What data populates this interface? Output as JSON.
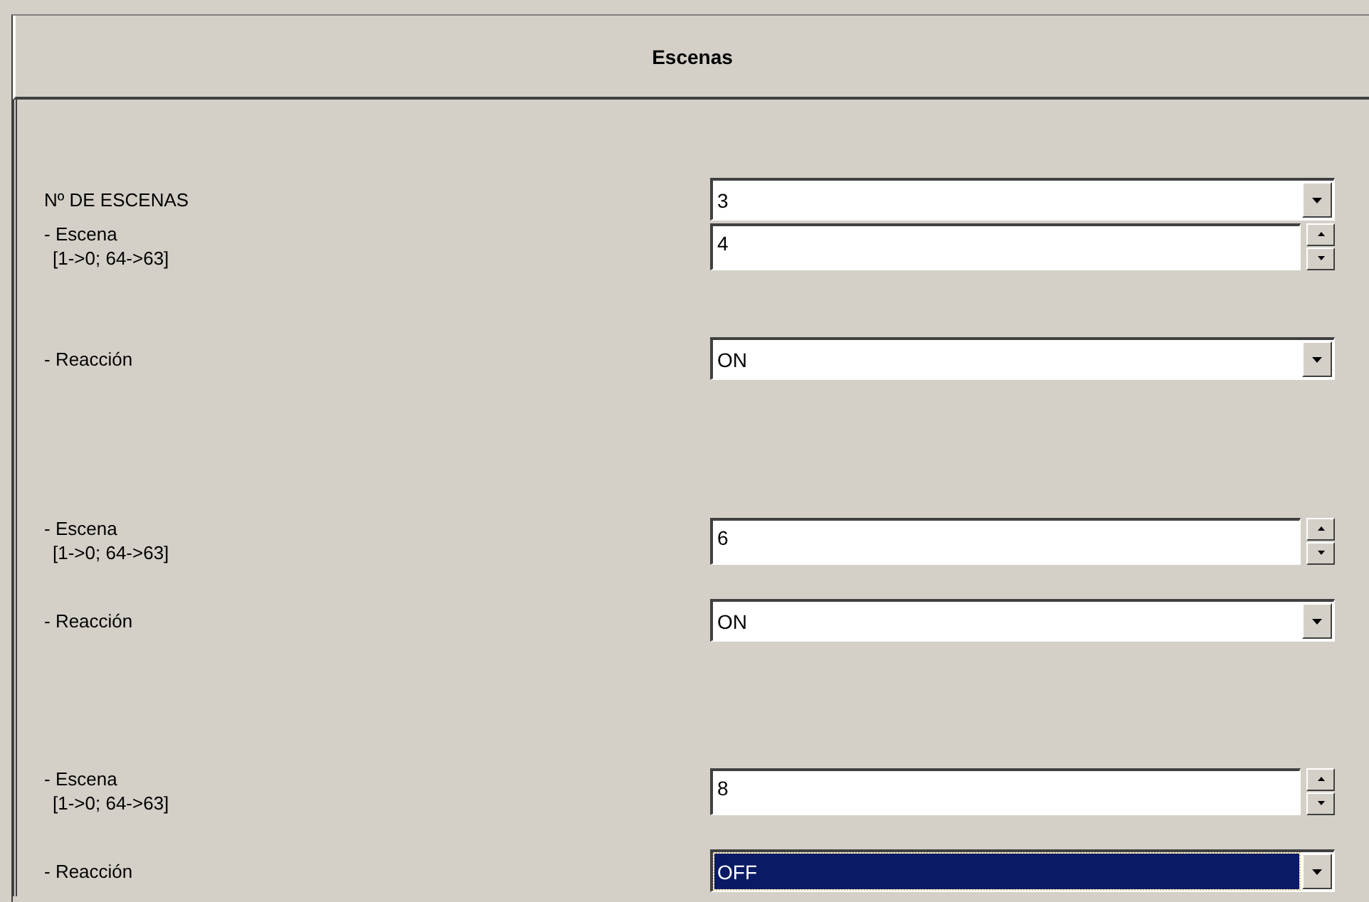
{
  "title": "Escenas",
  "count": {
    "label": "Nº DE ESCENAS",
    "value": "3"
  },
  "scenes": [
    {
      "scene_label": "- Escena",
      "scene_range": "[1->0; 64->63]",
      "scene_value": "4",
      "reaction_label": "- Reacción",
      "reaction_value": "ON",
      "reaction_focused": false
    },
    {
      "scene_label": "- Escena",
      "scene_range": "[1->0; 64->63]",
      "scene_value": "6",
      "reaction_label": "- Reacción",
      "reaction_value": "ON",
      "reaction_focused": false
    },
    {
      "scene_label": "- Escena",
      "scene_range": "[1->0; 64->63]",
      "scene_value": "8",
      "reaction_label": "- Reacción",
      "reaction_value": "OFF",
      "reaction_focused": true
    }
  ]
}
